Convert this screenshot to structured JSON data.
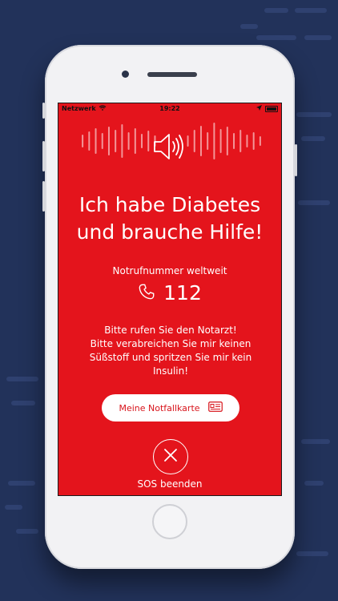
{
  "statusbar": {
    "carrier": "Netzwerk",
    "time": "19:22"
  },
  "icons": [
    "speaker-icon",
    "phone-icon",
    "id-card-icon",
    "close-icon",
    "wifi-icon",
    "location-icon",
    "battery-icon"
  ],
  "headline": {
    "line1": "Ich habe Diabetes",
    "line2": "und brauche Hilfe!"
  },
  "hotline": {
    "label": "Notrufnummer weltweit",
    "number": "112"
  },
  "instructions": {
    "line1": "Bitte rufen Sie den Notarzt!",
    "line2": "Bitte verabreichen Sie mir keinen",
    "line3": "Süßstoff und spritzen Sie mir kein",
    "line4": "Insulin!"
  },
  "card_button": {
    "label": "Meine Notfallkarte"
  },
  "sos": {
    "label": "SOS beenden"
  },
  "colors": {
    "background": "#22325a",
    "screen": "#e4141c",
    "accent_text": "#d8141b",
    "white": "#ffffff"
  }
}
